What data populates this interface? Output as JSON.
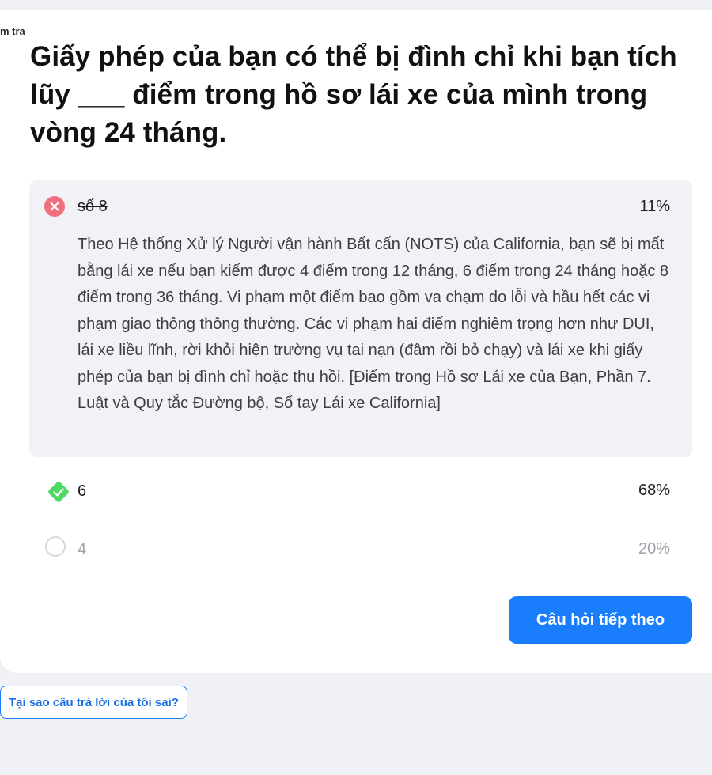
{
  "breadcrumb": "m tra",
  "question": "Giấy phép của bạn có thể bị đình chỉ khi bạn tích lũy ___ điểm trong hồ sơ lái xe của mình trong vòng 24 tháng.",
  "answers": [
    {
      "label": "số 8",
      "percent": "11%",
      "state": "wrong",
      "icon": "x-circle-icon",
      "explanation": "Theo Hệ thống Xử lý Người vận hành Bất cẩn (NOTS) của California, bạn sẽ bị mất bằng lái xe nếu bạn kiếm được 4 điểm trong 12 tháng, 6 điểm trong 24 tháng hoặc 8 điểm trong 36 tháng. Vi phạm một điểm bao gồm va chạm do lỗi và hầu hết các vi phạm giao thông thông thường. Các vi phạm hai điểm nghiêm trọng hơn như DUI, lái xe liều lĩnh, rời khỏi hiện trường vụ tai nạn (đâm rồi bỏ chạy) và lái xe khi giấy phép của bạn bị đình chỉ hoặc thu hồi. [Điểm trong Hồ sơ Lái xe của Bạn, Phần 7. Luật và Quy tắc Đường bộ, Sổ tay Lái xe California]"
    },
    {
      "label": "6",
      "percent": "68%",
      "state": "correct",
      "icon": "check-diamond-icon"
    },
    {
      "label": "4",
      "percent": "20%",
      "state": "unselected",
      "icon": "empty-circle-icon"
    }
  ],
  "next_button": "Câu hỏi tiếp theo",
  "why_wrong_button": "Tại sao câu trả lời của tôi sai?",
  "colors": {
    "wrong": "#f1707f",
    "correct": "#4cd964",
    "primary": "#1a7dfb",
    "page_bg": "#f0f1f6"
  }
}
